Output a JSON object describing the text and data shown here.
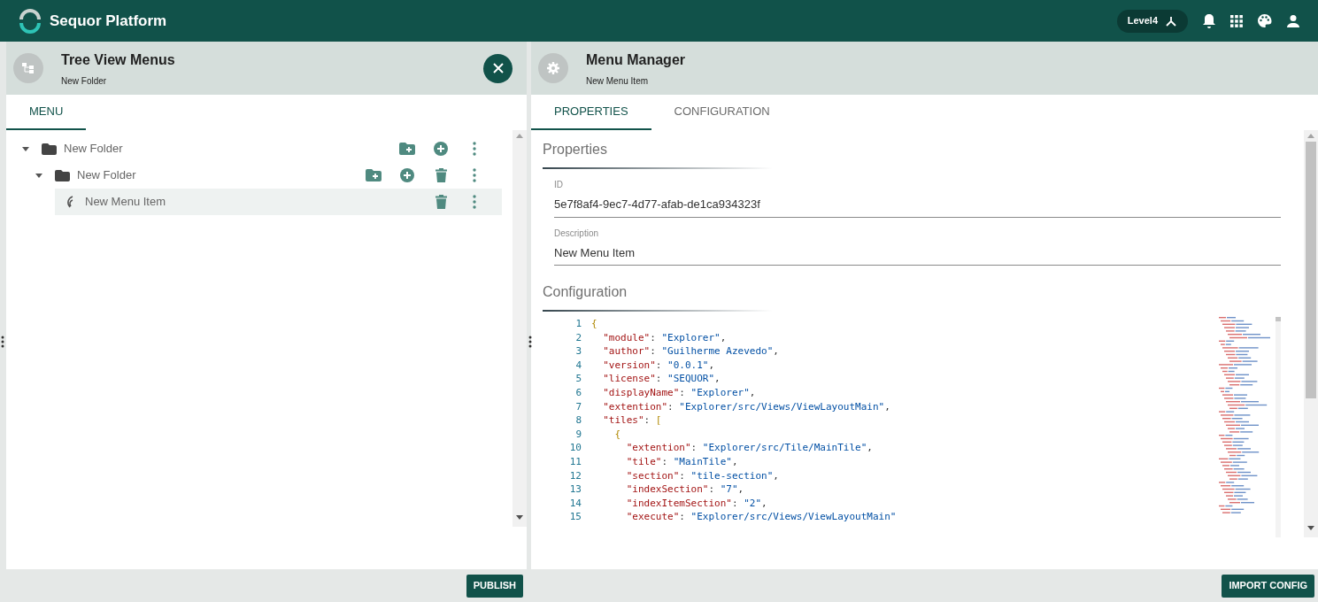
{
  "app_bar": {
    "title": "Sequor Platform",
    "level_chip": "Level4"
  },
  "left_panel": {
    "title": "Tree View Menus",
    "subtitle": "New Folder",
    "tabs": [
      {
        "label": "MENU",
        "selected": true
      }
    ],
    "tree": [
      {
        "kind": "folder",
        "label": "New Folder",
        "expanded": true,
        "selected": false,
        "actions": [
          {
            "kind": "add_folder"
          },
          {
            "kind": "add"
          },
          {
            "kind": "more"
          }
        ],
        "children": [
          {
            "kind": "folder",
            "label": "New Folder",
            "expanded": true,
            "selected": false,
            "actions": [
              {
                "kind": "add_folder"
              },
              {
                "kind": "add"
              },
              {
                "kind": "delete"
              },
              {
                "kind": "more"
              }
            ],
            "children": [
              {
                "kind": "item",
                "label": "New Menu Item",
                "selected": true,
                "actions": [
                  {
                    "kind": "delete"
                  },
                  {
                    "kind": "more"
                  }
                ]
              }
            ]
          }
        ]
      }
    ],
    "footer_button": "PUBLISH"
  },
  "right_panel": {
    "title": "Menu Manager",
    "subtitle": "New Menu Item",
    "tabs": [
      {
        "label": "PROPERTIES",
        "selected": true
      },
      {
        "label": "CONFIGURATION",
        "selected": false
      }
    ],
    "properties_heading": "Properties",
    "fields": [
      {
        "label": "ID",
        "value": "5e7f8af4-9ec7-4d77-afab-de1ca934323f"
      },
      {
        "label": "Description",
        "value": "New Menu Item"
      }
    ],
    "configuration_heading": "Configuration",
    "code_lines": [
      {
        "number": "1",
        "parts": [
          {
            "kind": "bracket",
            "text": "{"
          }
        ]
      },
      {
        "number": "2",
        "parts": [
          {
            "kind": "key",
            "text": "  \"module\""
          },
          {
            "kind": "punct",
            "text": ": "
          },
          {
            "kind": "string",
            "text": "\"Explorer\""
          },
          {
            "kind": "punct",
            "text": ","
          }
        ]
      },
      {
        "number": "3",
        "parts": [
          {
            "kind": "key",
            "text": "  \"author\""
          },
          {
            "kind": "punct",
            "text": ": "
          },
          {
            "kind": "string",
            "text": "\"Guilherme Azevedo\""
          },
          {
            "kind": "punct",
            "text": ","
          }
        ]
      },
      {
        "number": "4",
        "parts": [
          {
            "kind": "key",
            "text": "  \"version\""
          },
          {
            "kind": "punct",
            "text": ": "
          },
          {
            "kind": "string",
            "text": "\"0.0.1\""
          },
          {
            "kind": "punct",
            "text": ","
          }
        ]
      },
      {
        "number": "5",
        "parts": [
          {
            "kind": "key",
            "text": "  \"license\""
          },
          {
            "kind": "punct",
            "text": ": "
          },
          {
            "kind": "string",
            "text": "\"SEQUOR\""
          },
          {
            "kind": "punct",
            "text": ","
          }
        ]
      },
      {
        "number": "6",
        "parts": [
          {
            "kind": "key",
            "text": "  \"displayName\""
          },
          {
            "kind": "punct",
            "text": ": "
          },
          {
            "kind": "string",
            "text": "\"Explorer\""
          },
          {
            "kind": "punct",
            "text": ","
          }
        ]
      },
      {
        "number": "7",
        "parts": [
          {
            "kind": "key",
            "text": "  \"extention\""
          },
          {
            "kind": "punct",
            "text": ": "
          },
          {
            "kind": "string",
            "text": "\"Explorer/src/Views/ViewLayoutMain\""
          },
          {
            "kind": "punct",
            "text": ","
          }
        ]
      },
      {
        "number": "8",
        "parts": [
          {
            "kind": "key",
            "text": "  \"tiles\""
          },
          {
            "kind": "punct",
            "text": ": "
          },
          {
            "kind": "bracket",
            "text": "["
          }
        ]
      },
      {
        "number": "9",
        "parts": [
          {
            "kind": "bracket",
            "text": "    {"
          }
        ]
      },
      {
        "number": "10",
        "parts": [
          {
            "kind": "key",
            "text": "      \"extention\""
          },
          {
            "kind": "punct",
            "text": ": "
          },
          {
            "kind": "string",
            "text": "\"Explorer/src/Tile/MainTile\""
          },
          {
            "kind": "punct",
            "text": ","
          }
        ]
      },
      {
        "number": "11",
        "parts": [
          {
            "kind": "key",
            "text": "      \"tile\""
          },
          {
            "kind": "punct",
            "text": ": "
          },
          {
            "kind": "string",
            "text": "\"MainTile\""
          },
          {
            "kind": "punct",
            "text": ","
          }
        ]
      },
      {
        "number": "12",
        "parts": [
          {
            "kind": "key",
            "text": "      \"section\""
          },
          {
            "kind": "punct",
            "text": ": "
          },
          {
            "kind": "string",
            "text": "\"tile-section\""
          },
          {
            "kind": "punct",
            "text": ","
          }
        ]
      },
      {
        "number": "13",
        "parts": [
          {
            "kind": "key",
            "text": "      \"indexSection\""
          },
          {
            "kind": "punct",
            "text": ": "
          },
          {
            "kind": "string",
            "text": "\"7\""
          },
          {
            "kind": "punct",
            "text": ","
          }
        ]
      },
      {
        "number": "14",
        "parts": [
          {
            "kind": "key",
            "text": "      \"indexItemSection\""
          },
          {
            "kind": "punct",
            "text": ": "
          },
          {
            "kind": "string",
            "text": "\"2\""
          },
          {
            "kind": "punct",
            "text": ","
          }
        ]
      },
      {
        "number": "15",
        "parts": [
          {
            "kind": "key",
            "text": "      \"execute\""
          },
          {
            "kind": "punct",
            "text": ": "
          },
          {
            "kind": "string",
            "text": "\"Explorer/src/Views/ViewLayoutMain\""
          }
        ]
      }
    ],
    "footer_button": "IMPORT CONFIG"
  }
}
